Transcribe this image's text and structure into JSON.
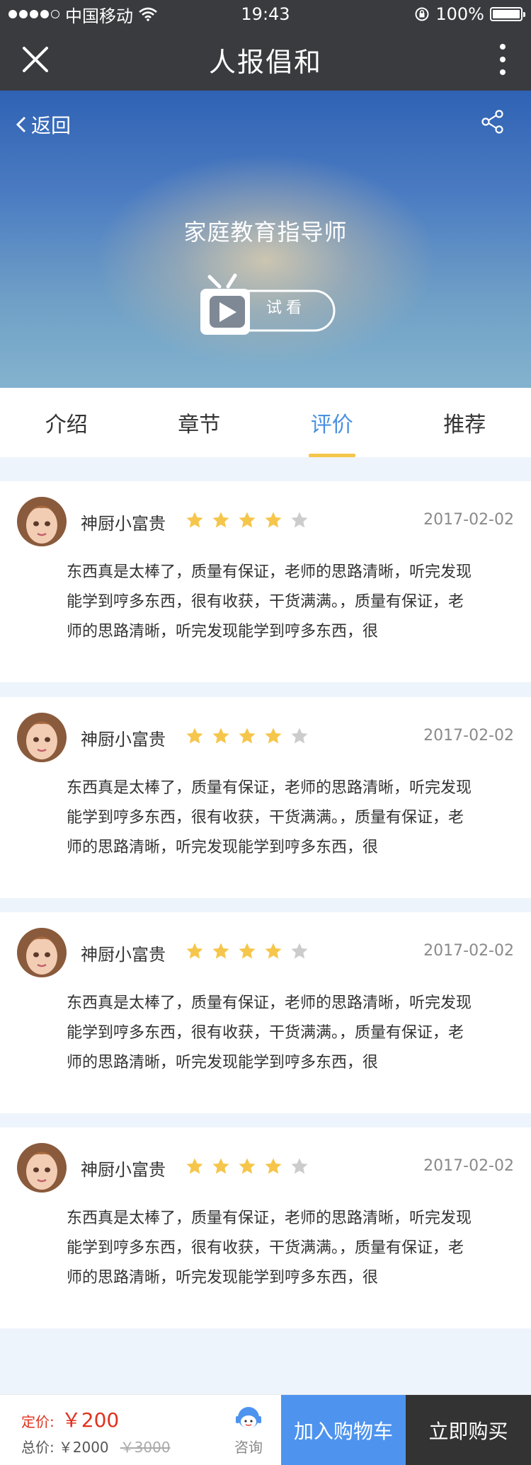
{
  "status_bar": {
    "carrier": "中国移动",
    "time": "19:43",
    "battery": "100%"
  },
  "nav": {
    "title": "人报倡和"
  },
  "banner": {
    "back_label": "返回",
    "course_title": "家庭教育指导师",
    "trial_label": "试看"
  },
  "tabs": [
    {
      "label": "介绍"
    },
    {
      "label": "章节"
    },
    {
      "label": "评价"
    },
    {
      "label": "推荐"
    }
  ],
  "active_tab": 2,
  "reviews": [
    {
      "name": "神厨小富贵",
      "rating": 4,
      "max_rating": 5,
      "date": "2017-02-02",
      "text": "东西真是太棒了，质量有保证，老师的思路清晰，听完发现能学到哼多东西，很有收获，干货满满。，质量有保证，老师的思路清晰，听完发现能学到哼多东西，很"
    },
    {
      "name": "神厨小富贵",
      "rating": 4,
      "max_rating": 5,
      "date": "2017-02-02",
      "text": "东西真是太棒了，质量有保证，老师的思路清晰，听完发现能学到哼多东西，很有收获，干货满满。，质量有保证，老师的思路清晰，听完发现能学到哼多东西，很"
    },
    {
      "name": "神厨小富贵",
      "rating": 4,
      "max_rating": 5,
      "date": "2017-02-02",
      "text": "东西真是太棒了，质量有保证，老师的思路清晰，听完发现能学到哼多东西，很有收获，干货满满。，质量有保证，老师的思路清晰，听完发现能学到哼多东西，很"
    },
    {
      "name": "神厨小富贵",
      "rating": 4,
      "max_rating": 5,
      "date": "2017-02-02",
      "text": "东西真是太棒了，质量有保证，老师的思路清晰，听完发现能学到哼多东西，很有收获，干货满满。，质量有保证，老师的思路清晰，听完发现能学到哼多东西，很"
    }
  ],
  "bottom": {
    "price_label": "定价:",
    "price": "￥200",
    "total_label": "总价:",
    "total": "￥2000",
    "original": "￥3000",
    "consult_label": "咨询",
    "add_cart_label": "加入购物车",
    "buy_label": "立即购买"
  },
  "colors": {
    "accent": "#4a90e2",
    "price": "#e0321f",
    "star_on": "#f5c64b",
    "star_off": "#cccccc",
    "cart_button": "#4e94ef",
    "buy_button": "#333333"
  }
}
